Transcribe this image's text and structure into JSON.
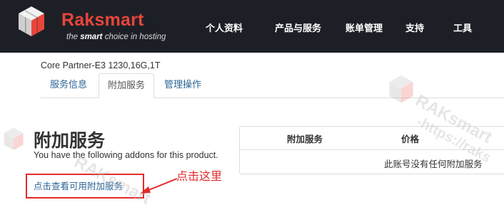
{
  "header": {
    "brand_name": "Raksmart",
    "tagline_prefix": "the ",
    "tagline_bold": "smart",
    "tagline_suffix": " choice in hosting",
    "nav": [
      "个人资料",
      "产品与服务",
      "账单管理",
      "支持",
      "工具"
    ]
  },
  "product": {
    "name": "Core Partner-E3 1230,16G,1T"
  },
  "tabs": [
    {
      "label": "服务信息",
      "active": false
    },
    {
      "label": "附加服务",
      "active": true
    },
    {
      "label": "管理操作",
      "active": false
    }
  ],
  "addons": {
    "title": "附加服务",
    "description": "You have the following addons for this product.",
    "link": "点击查看可用附加服务"
  },
  "addons_table": {
    "headers": [
      "附加服务",
      "价格"
    ],
    "empty_message": "此账号没有任何附加服务"
  },
  "annotation": {
    "text": "点击这里",
    "color": "#e32a2a"
  },
  "watermark": {
    "line1": "RAKsmart",
    "line2": "-https://raks"
  },
  "colors": {
    "header_bg": "#1d1f27",
    "brand": "#e8463a",
    "link": "#2a6496",
    "annotation": "#e32a2a"
  },
  "icons": {
    "logo": "raksmart-cube-logo-icon",
    "arrow": "red-arrow-icon"
  }
}
